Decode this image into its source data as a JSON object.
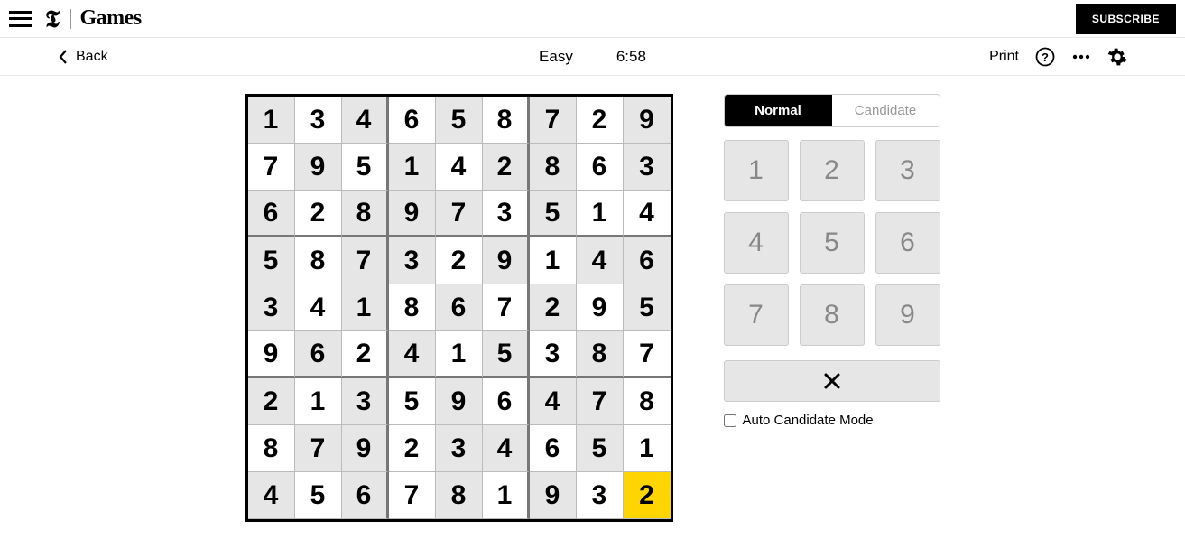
{
  "header": {
    "brand_t": "𝕿",
    "brand_games": "Games",
    "subscribe": "SUBSCRIBE"
  },
  "toolbar": {
    "back": "Back",
    "difficulty": "Easy",
    "time": "6:58",
    "print": "Print"
  },
  "board": {
    "selected": [
      8,
      8
    ],
    "cells": [
      [
        {
          "v": "1",
          "p": true
        },
        {
          "v": "3",
          "p": false
        },
        {
          "v": "4",
          "p": true
        },
        {
          "v": "6",
          "p": false
        },
        {
          "v": "5",
          "p": true
        },
        {
          "v": "8",
          "p": false
        },
        {
          "v": "7",
          "p": true
        },
        {
          "v": "2",
          "p": false
        },
        {
          "v": "9",
          "p": true
        }
      ],
      [
        {
          "v": "7",
          "p": false
        },
        {
          "v": "9",
          "p": true
        },
        {
          "v": "5",
          "p": false
        },
        {
          "v": "1",
          "p": true
        },
        {
          "v": "4",
          "p": false
        },
        {
          "v": "2",
          "p": true
        },
        {
          "v": "8",
          "p": true
        },
        {
          "v": "6",
          "p": false
        },
        {
          "v": "3",
          "p": true
        }
      ],
      [
        {
          "v": "6",
          "p": true
        },
        {
          "v": "2",
          "p": false
        },
        {
          "v": "8",
          "p": true
        },
        {
          "v": "9",
          "p": true
        },
        {
          "v": "7",
          "p": true
        },
        {
          "v": "3",
          "p": false
        },
        {
          "v": "5",
          "p": true
        },
        {
          "v": "1",
          "p": false
        },
        {
          "v": "4",
          "p": false
        }
      ],
      [
        {
          "v": "5",
          "p": true
        },
        {
          "v": "8",
          "p": false
        },
        {
          "v": "7",
          "p": true
        },
        {
          "v": "3",
          "p": true
        },
        {
          "v": "2",
          "p": false
        },
        {
          "v": "9",
          "p": true
        },
        {
          "v": "1",
          "p": false
        },
        {
          "v": "4",
          "p": true
        },
        {
          "v": "6",
          "p": true
        }
      ],
      [
        {
          "v": "3",
          "p": true
        },
        {
          "v": "4",
          "p": false
        },
        {
          "v": "1",
          "p": true
        },
        {
          "v": "8",
          "p": false
        },
        {
          "v": "6",
          "p": true
        },
        {
          "v": "7",
          "p": false
        },
        {
          "v": "2",
          "p": true
        },
        {
          "v": "9",
          "p": false
        },
        {
          "v": "5",
          "p": true
        }
      ],
      [
        {
          "v": "9",
          "p": false
        },
        {
          "v": "6",
          "p": true
        },
        {
          "v": "2",
          "p": false
        },
        {
          "v": "4",
          "p": true
        },
        {
          "v": "1",
          "p": false
        },
        {
          "v": "5",
          "p": true
        },
        {
          "v": "3",
          "p": false
        },
        {
          "v": "8",
          "p": true
        },
        {
          "v": "7",
          "p": false
        }
      ],
      [
        {
          "v": "2",
          "p": true
        },
        {
          "v": "1",
          "p": false
        },
        {
          "v": "3",
          "p": true
        },
        {
          "v": "5",
          "p": false
        },
        {
          "v": "9",
          "p": true
        },
        {
          "v": "6",
          "p": false
        },
        {
          "v": "4",
          "p": true
        },
        {
          "v": "7",
          "p": true
        },
        {
          "v": "8",
          "p": false
        }
      ],
      [
        {
          "v": "8",
          "p": false
        },
        {
          "v": "7",
          "p": true
        },
        {
          "v": "9",
          "p": true
        },
        {
          "v": "2",
          "p": false
        },
        {
          "v": "3",
          "p": true
        },
        {
          "v": "4",
          "p": true
        },
        {
          "v": "6",
          "p": false
        },
        {
          "v": "5",
          "p": true
        },
        {
          "v": "1",
          "p": false
        }
      ],
      [
        {
          "v": "4",
          "p": true
        },
        {
          "v": "5",
          "p": false
        },
        {
          "v": "6",
          "p": true
        },
        {
          "v": "7",
          "p": false
        },
        {
          "v": "8",
          "p": true
        },
        {
          "v": "1",
          "p": false
        },
        {
          "v": "9",
          "p": true
        },
        {
          "v": "3",
          "p": false
        },
        {
          "v": "2",
          "p": false
        }
      ]
    ]
  },
  "panel": {
    "mode_normal": "Normal",
    "mode_candidate": "Candidate",
    "keys": [
      "1",
      "2",
      "3",
      "4",
      "5",
      "6",
      "7",
      "8",
      "9"
    ],
    "auto_label": "Auto Candidate Mode",
    "auto_checked": false
  }
}
